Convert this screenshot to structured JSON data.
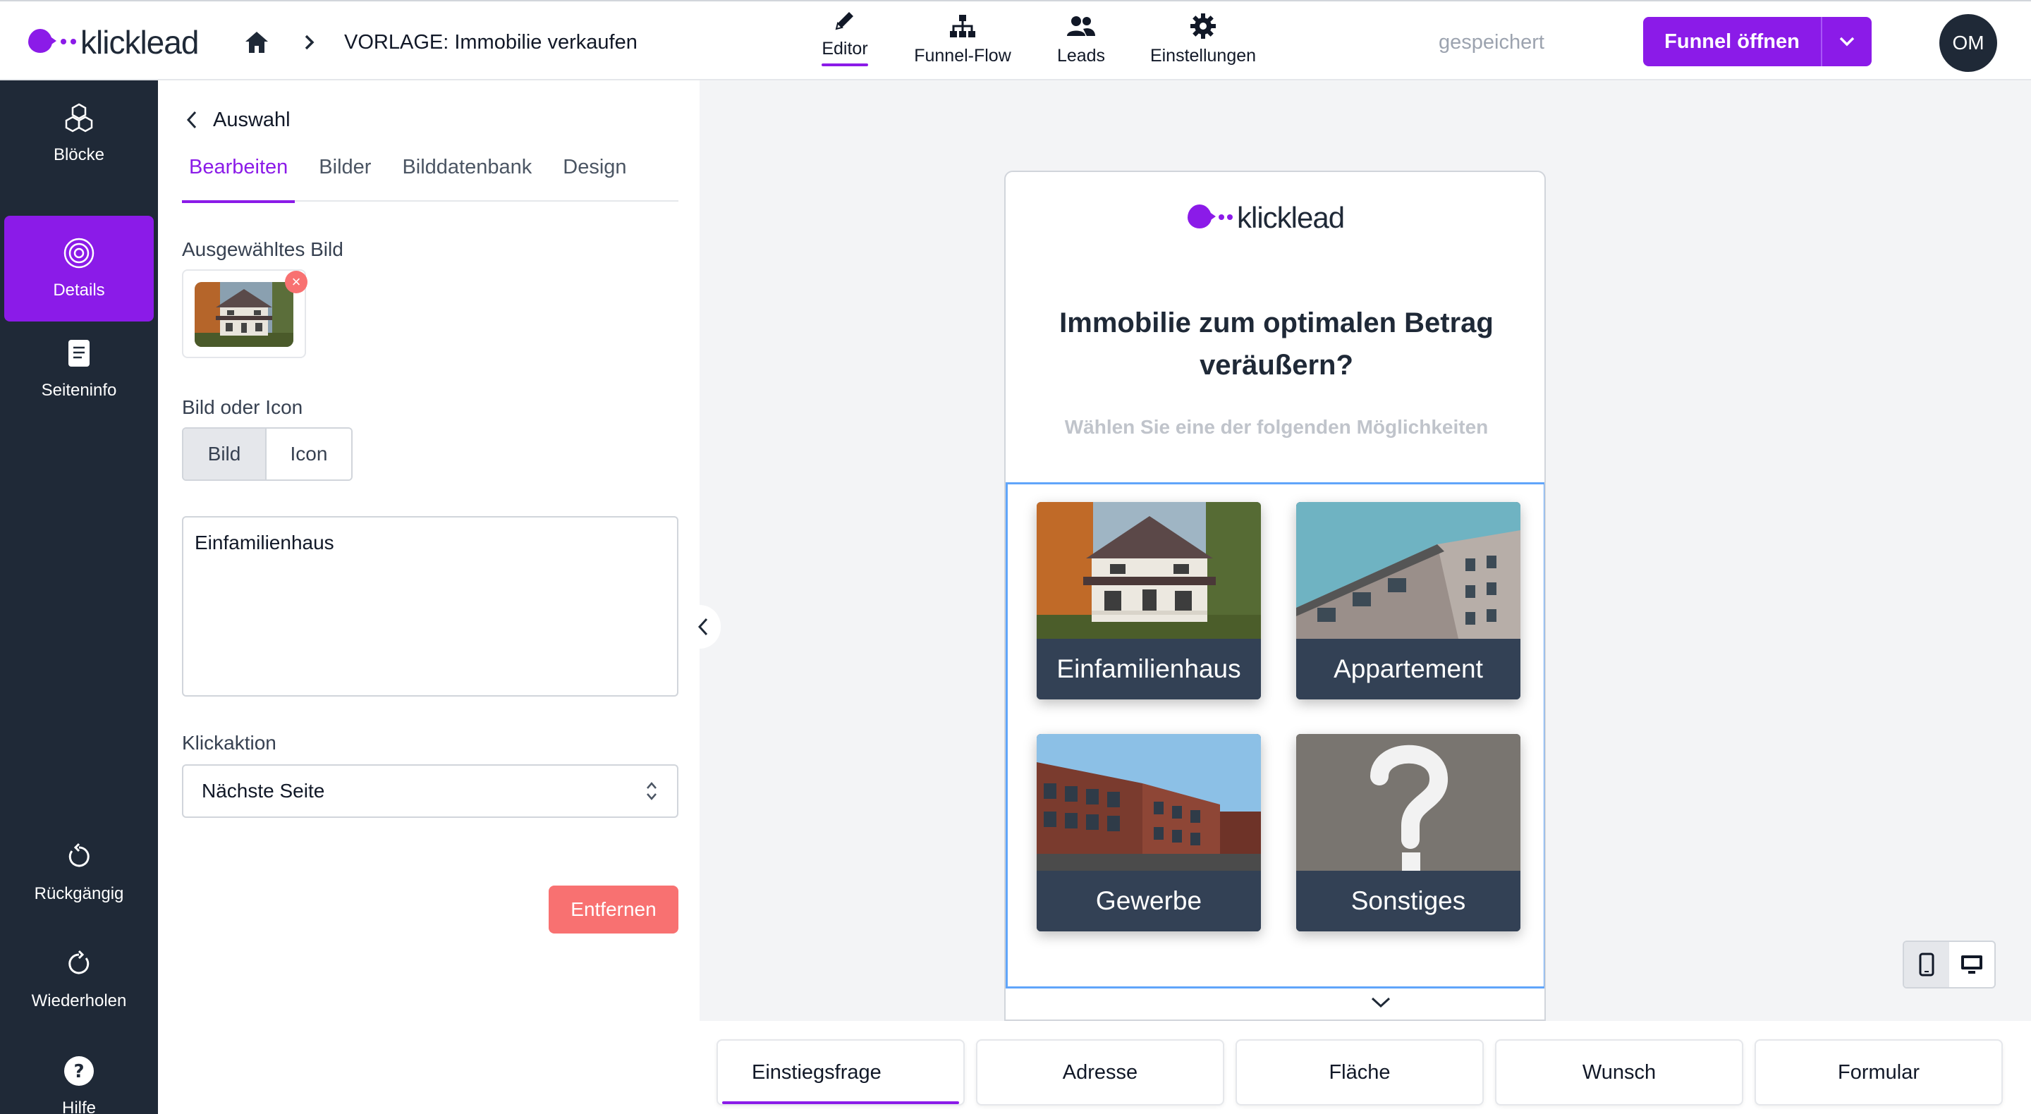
{
  "app": {
    "brand": "klicklead",
    "breadcrumb_title": "VORLAGE: Immobilie verkaufen",
    "save_status": "gespeichert",
    "accent_color": "#8b1be8",
    "sidebar_color": "#1f2937",
    "user_initials": "OM"
  },
  "topnav": [
    {
      "label": "Editor",
      "icon": "pencil-icon",
      "active": true
    },
    {
      "label": "Funnel-Flow",
      "icon": "sitemap-icon",
      "active": false
    },
    {
      "label": "Leads",
      "icon": "users-icon",
      "active": false
    },
    {
      "label": "Einstellungen",
      "icon": "gear-icon",
      "active": false
    }
  ],
  "actions": {
    "open_funnel": "Funnel öffnen"
  },
  "sidebar": {
    "items": [
      {
        "label": "Blöcke",
        "icon": "cubes-icon"
      },
      {
        "label": "Details",
        "icon": "target-icon",
        "active": true
      },
      {
        "label": "Seiteninfo",
        "icon": "document-icon"
      },
      {
        "label": "Rückgängig",
        "icon": "undo-icon"
      },
      {
        "label": "Wiederholen",
        "icon": "redo-icon"
      },
      {
        "label": "Hilfe",
        "icon": "help-icon"
      }
    ]
  },
  "panel": {
    "back_label": "Auswahl",
    "tabs": [
      {
        "label": "Bearbeiten",
        "active": true
      },
      {
        "label": "Bilder"
      },
      {
        "label": "Bilddatenbank"
      },
      {
        "label": "Design"
      }
    ],
    "selected_image_label": "Ausgewähltes Bild",
    "image_or_icon_label": "Bild oder Icon",
    "toggle": {
      "image": "Bild",
      "icon": "Icon",
      "selected": "Bild"
    },
    "text_value": "Einfamilienhaus",
    "click_action_label": "Klickaktion",
    "click_action_value": "Nächste Seite",
    "remove_button": "Entfernen",
    "danger_color": "#f87171"
  },
  "preview": {
    "brand": "klicklead",
    "title": "Immobilie zum optimalen Betrag veräußern?",
    "subtitle": "Wählen Sie eine der folgenden Möglichkeiten",
    "options": [
      {
        "label": "Einfamilienhaus"
      },
      {
        "label": "Appartement"
      },
      {
        "label": "Gewerbe"
      },
      {
        "label": "Sonstiges"
      }
    ]
  },
  "pages": [
    {
      "label": "Einstiegsfrage",
      "active": true
    },
    {
      "label": "Adresse"
    },
    {
      "label": "Fläche"
    },
    {
      "label": "Wunsch"
    },
    {
      "label": "Formular"
    }
  ]
}
